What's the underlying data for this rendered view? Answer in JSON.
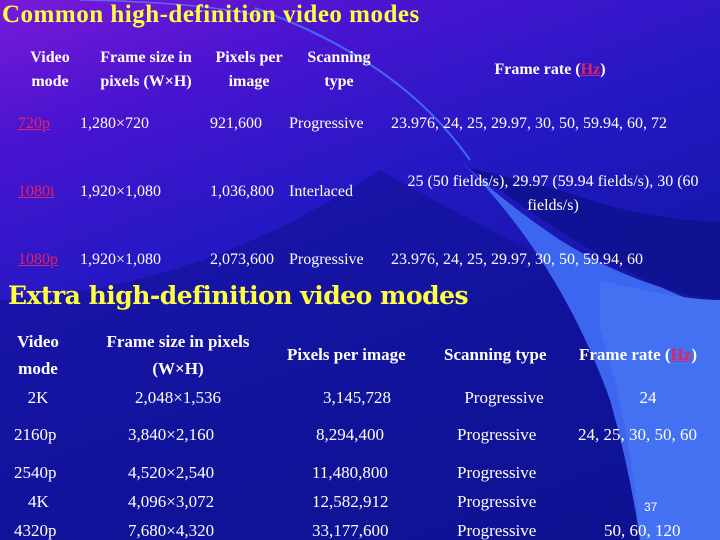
{
  "slide": {
    "page_number": "37",
    "colors": {
      "title": "#ffff40",
      "text": "#ffffff",
      "link": "#e0245e",
      "background": "#1416a8"
    }
  },
  "common": {
    "title": "Common high-definition video modes",
    "headers": {
      "mode": [
        "Video",
        "mode"
      ],
      "frame_size": [
        "Frame size in",
        "pixels (W×H)"
      ],
      "pixels": [
        "Pixels per",
        "image"
      ],
      "scanning": [
        "Scanning",
        "type"
      ],
      "frame_rate_prefix": "Frame rate (",
      "frame_rate_link": "Hz",
      "frame_rate_suffix": ")"
    },
    "rows": [
      {
        "mode": "720p",
        "frame_size": "1,280×720",
        "pixels": "921,600",
        "scanning": "Progressive",
        "frame_rate": [
          "23.976, 24, 25, 29.97, 30, 50, 59.94, 60, 72"
        ]
      },
      {
        "mode": "1080i",
        "frame_size": "1,920×1,080",
        "pixels": "1,036,800",
        "scanning": "Interlaced",
        "frame_rate": [
          "25 (50 fields/s), 29.97 (59.94 fields/s), 30 (60",
          "fields/s)"
        ]
      },
      {
        "mode": "1080p",
        "frame_size": "1,920×1,080",
        "pixels": "2,073,600",
        "scanning": "Progressive",
        "frame_rate": [
          "23.976, 24, 25, 29.97, 30, 50, 59.94, 60"
        ]
      }
    ]
  },
  "extra": {
    "title": "Extra high-definition video modes",
    "headers": {
      "mode": [
        "Video",
        "mode"
      ],
      "frame_size": [
        "Frame size in pixels",
        "(W×H)"
      ],
      "pixels": "Pixels per image",
      "scanning": "Scanning type",
      "frame_rate_prefix": "Frame rate (",
      "frame_rate_link": "Hz",
      "frame_rate_suffix": ")"
    },
    "rows": [
      {
        "mode": "2K",
        "frame_size": "2,048×1,536",
        "pixels": "3,145,728",
        "scanning": "Progressive",
        "frame_rate": "24"
      },
      {
        "mode": "2160p",
        "frame_size": "3,840×2,160",
        "pixels": "8,294,400",
        "scanning": "Progressive",
        "frame_rate": "24, 25, 30, 50, 60"
      },
      {
        "mode": "2540p",
        "frame_size": "4,520×2,540",
        "pixels": "11,480,800",
        "scanning": "Progressive",
        "frame_rate": ""
      },
      {
        "mode": "4K",
        "frame_size": "4,096×3,072",
        "pixels": "12,582,912",
        "scanning": "Progressive",
        "frame_rate": ""
      },
      {
        "mode": "4320p",
        "frame_size": "7,680×4,320",
        "pixels": "33,177,600",
        "scanning": "Progressive",
        "frame_rate": "50, 60, 120"
      }
    ]
  }
}
